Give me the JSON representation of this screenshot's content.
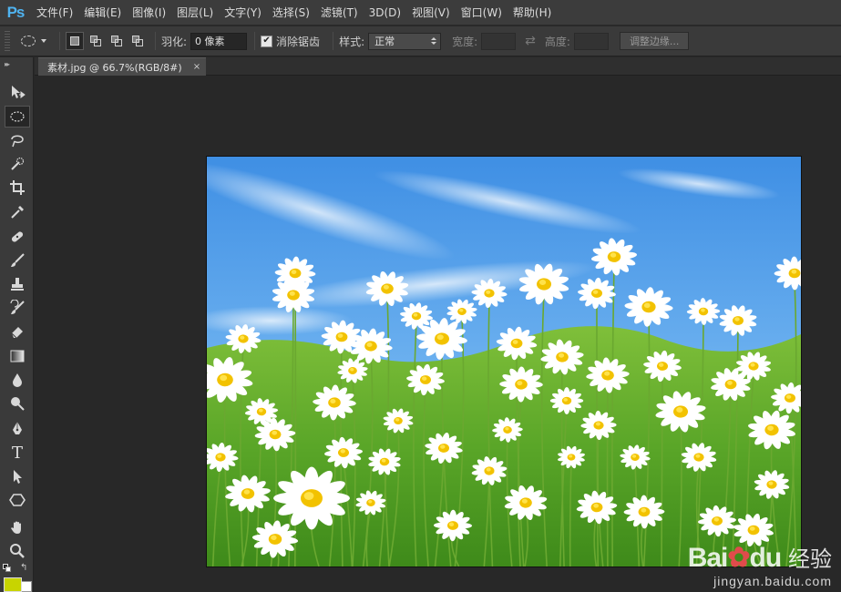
{
  "app": {
    "logo": "Ps"
  },
  "menu": [
    "文件(F)",
    "编辑(E)",
    "图像(I)",
    "图层(L)",
    "文字(Y)",
    "选择(S)",
    "滤镜(T)",
    "3D(D)",
    "视图(V)",
    "窗口(W)",
    "帮助(H)"
  ],
  "options": {
    "feather_label": "羽化:",
    "feather_value": "0 像素",
    "antialias_label": "消除锯齿",
    "style_label": "样式:",
    "style_value": "正常",
    "width_label": "宽度:",
    "height_label": "高度:",
    "refine_label": "调整边缘..."
  },
  "document": {
    "tab_title": "素材.jpg @ 66.7%(RGB/8#)",
    "close": "×"
  },
  "toolbox": {
    "collapse": "▸▸",
    "tools": [
      "move-icon",
      "ellipse-marquee-icon",
      "lasso-icon",
      "quick-select-icon",
      "crop-icon",
      "eyedropper-icon",
      "healing-brush-icon",
      "brush-icon",
      "clone-stamp-icon",
      "history-brush-icon",
      "eraser-icon",
      "gradient-icon",
      "blur-icon",
      "dodge-icon",
      "pen-icon",
      "type-icon",
      "path-select-icon",
      "shape-icon",
      "hand-icon",
      "zoom-icon"
    ],
    "type_glyph": "T",
    "foreground_color": "#c8d400",
    "background_color": "#ffffff"
  },
  "watermark": {
    "brand": "Bai",
    "brand2": "du",
    "cn": "经验",
    "url": "jingyan.baidu.com"
  },
  "colors": {
    "menubar": "#3c3c3c",
    "canvas": "#282828",
    "sky": "#3f95e6"
  }
}
